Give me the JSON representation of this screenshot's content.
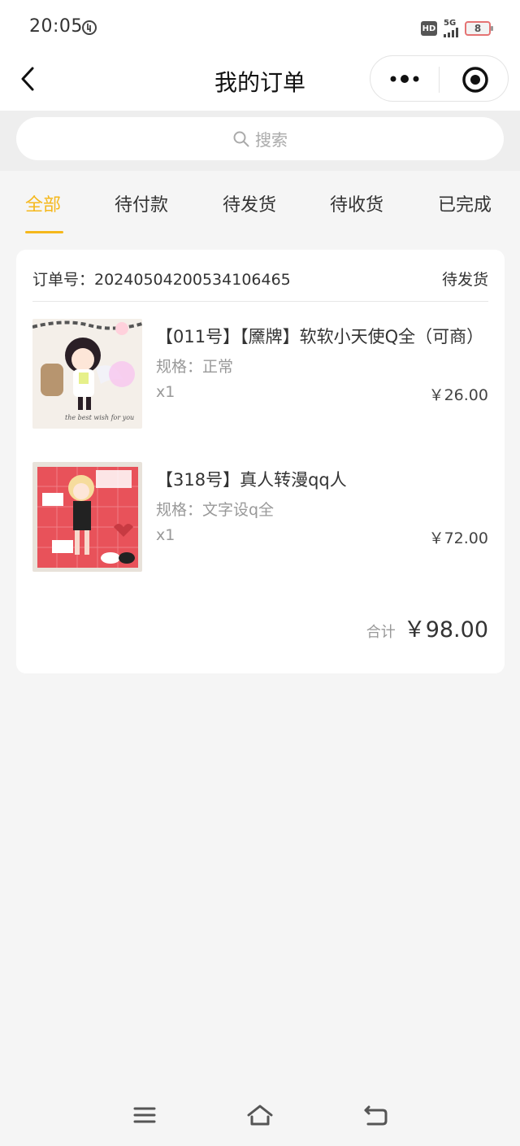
{
  "status_bar": {
    "time": "20:05",
    "network": "5G",
    "hd": "HD",
    "battery": "8",
    "battery_color": "#e57373"
  },
  "nav": {
    "title": "我的订单",
    "back_icon": "chevron-left-icon",
    "more_icon": "more-dots-icon",
    "close_icon": "target-circle-icon"
  },
  "search": {
    "placeholder": "搜索",
    "icon": "search-icon"
  },
  "tabs": [
    {
      "label": "全部",
      "active": true
    },
    {
      "label": "待付款",
      "active": false
    },
    {
      "label": "待发货",
      "active": false
    },
    {
      "label": "待收货",
      "active": false
    },
    {
      "label": "已完成",
      "active": false
    }
  ],
  "accent_color": "#f5b81c",
  "order": {
    "order_no_label": "订单号：20240504200534106465",
    "status": "待发货",
    "items": [
      {
        "title": "【011号】【黡牌】软软小天使Q全（可商）",
        "spec": "规格：正常",
        "qty": "x1",
        "price": "￥26.00"
      },
      {
        "title": "【318号】真人转漫qq人",
        "spec": "规格：文字设q全",
        "qty": "x1",
        "price": "￥72.00"
      }
    ],
    "total_label": "合计",
    "total_value": "￥98.00"
  },
  "system_nav": {
    "menu_icon": "menu-icon",
    "home_icon": "home-icon",
    "back_icon": "back-arrow-icon"
  }
}
